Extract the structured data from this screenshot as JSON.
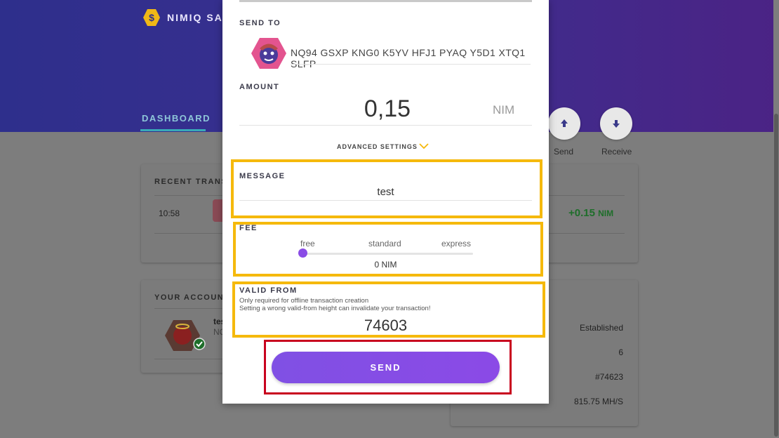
{
  "app": {
    "brand": "NIMIQ SAF"
  },
  "nav": {
    "dashboard_tab": "DASHBOARD"
  },
  "actions": {
    "send_label": "Send",
    "receive_label": "Receive"
  },
  "recent": {
    "title": "RECENT TRANS",
    "time": "10:58",
    "amount": "+0.15",
    "unit": "NIM"
  },
  "accounts": {
    "title": "YOUR ACCOUN",
    "name": "tes",
    "address": "NQ"
  },
  "network": {
    "status": "Established",
    "peers": "6",
    "height": "#74623",
    "hashrate": "815.75 MH/S"
  },
  "modal": {
    "send_to_label": "SEND TO",
    "recipient_address": "NQ94 GSXP KNG0 K5YV HFJ1 PYAQ Y5D1 XTQ1 SLFP",
    "amount_label": "AMOUNT",
    "amount_value": "0,15",
    "amount_unit": "NIM",
    "advanced_settings": "ADVANCED SETTINGS",
    "message_label": "MESSAGE",
    "message_value": "test",
    "fee_label": "FEE",
    "fee_options": [
      "free",
      "standard",
      "express"
    ],
    "fee_selected": "free",
    "fee_value": "0 NIM",
    "valid_from_label": "VALID FROM",
    "valid_from_note1": "Only required for offline transaction creation",
    "valid_from_note2": "Setting a wrong valid-from height can invalidate your transaction!",
    "valid_from_value": "74603",
    "send_button": "SEND"
  },
  "colors": {
    "accent_purple": "#8b4ae6",
    "highlight_yellow": "#f5b90c",
    "highlight_red": "#c8001e",
    "positive_green": "#1e8a2a"
  },
  "icons": [
    "hexagon-dollar-logo",
    "arrow-up-icon",
    "arrow-down-icon",
    "chevron-down-icon",
    "identicon"
  ]
}
